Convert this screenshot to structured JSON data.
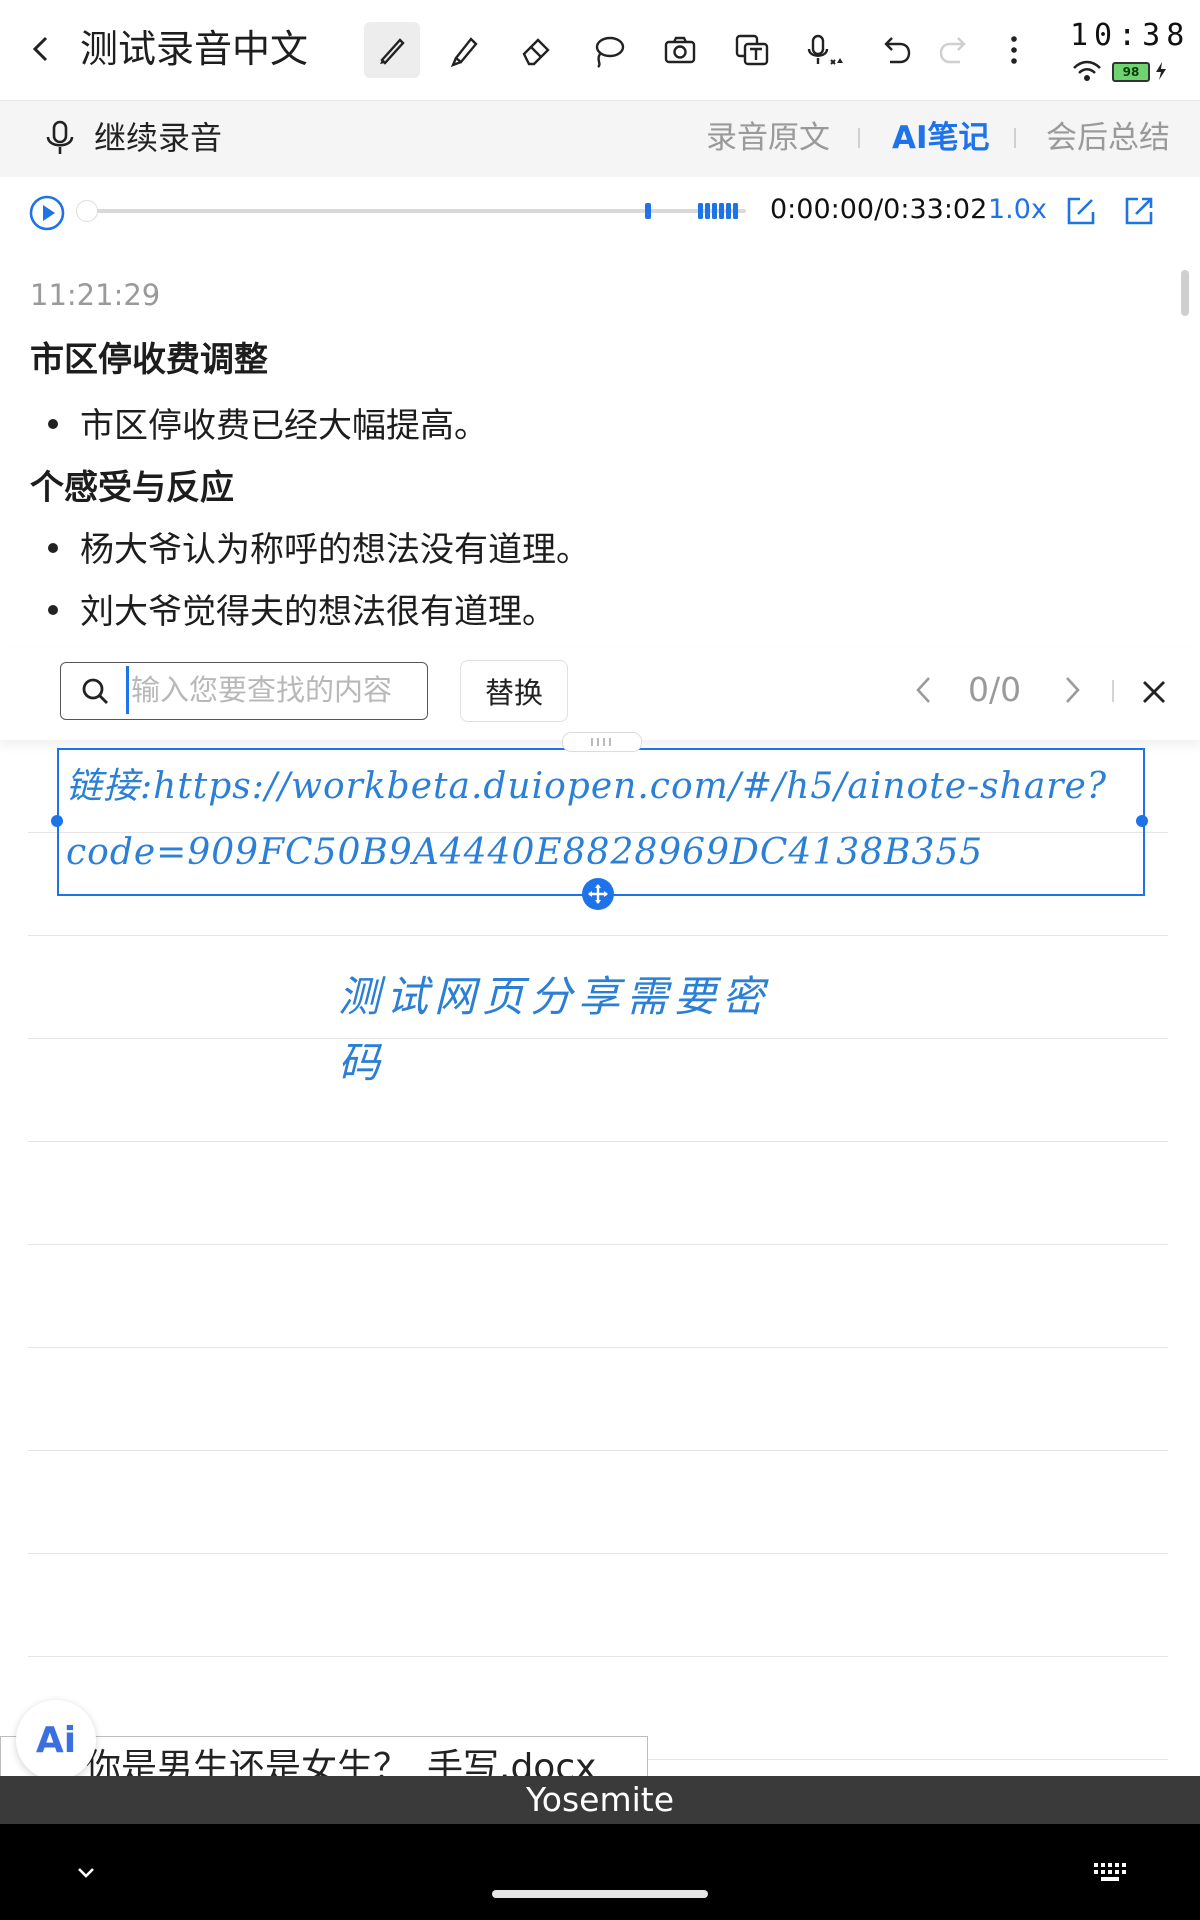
{
  "toolbar": {
    "title": "测试录音中文",
    "tools": [
      "brush",
      "highlighter",
      "eraser",
      "lasso",
      "camera",
      "text-recognize",
      "voice-input",
      "undo",
      "redo",
      "more"
    ]
  },
  "status": {
    "time": "10:38",
    "battery": "98"
  },
  "record_bar": {
    "continue_label": "继续录音",
    "tabs": [
      {
        "label": "录音原文",
        "active": false
      },
      {
        "label": "AI笔记",
        "active": true
      },
      {
        "label": "会后总结",
        "active": false
      }
    ]
  },
  "player": {
    "time": "0:00:00/0:33:02",
    "speed": "1.0x",
    "progress": 0
  },
  "notes": {
    "timestamp": "11:21:29",
    "sections": [
      {
        "heading": "市区停收费调整",
        "bullets": [
          "市区停收费已经大幅提高。"
        ]
      },
      {
        "heading": "个感受与反应",
        "bullets": [
          "杨大爷认为称呼的想法没有道理。",
          "刘大爷觉得夫的想法很有道理。"
        ]
      }
    ]
  },
  "find": {
    "placeholder": "输入您要查找的内容",
    "value": "",
    "replace_label": "替换",
    "match_count": "0/0"
  },
  "handwriting": {
    "link_line1": "链接:https://workbeta.duiopen.com/#/h5/ainote-share?",
    "link_line2": "code=909FC50B9A4440E8828969DC4138B355",
    "note_line1": "测试网页分享需要密",
    "note_line2": "码"
  },
  "bottom": {
    "ai_label": "Ai",
    "doc_popup": "你是男生还是女生？_手写.docx",
    "keyboard_suggestion": "Yosemite"
  },
  "colors": {
    "accent": "#1f73e8",
    "ink": "#2b7fd4"
  }
}
